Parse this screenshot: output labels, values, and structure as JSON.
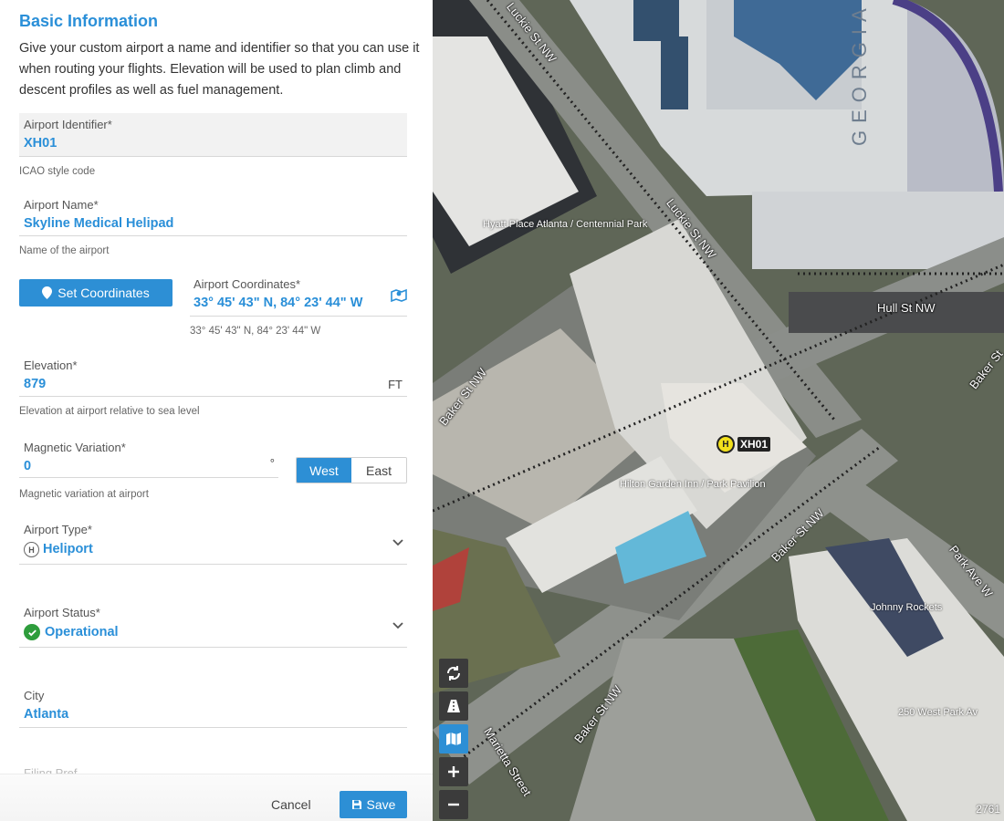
{
  "form": {
    "section_title": "Basic Information",
    "intro": "Give your custom airport a name and identifier so that you can use it when routing your flights. Elevation will be used to plan climb and descent profiles as well as fuel management.",
    "identifier": {
      "label": "Airport Identifier*",
      "value": "XH01",
      "hint": "ICAO style code"
    },
    "name": {
      "label": "Airport Name*",
      "value": "Skyline Medical Helipad",
      "hint": "Name of the airport"
    },
    "coordinates": {
      "button_label": "Set Coordinates",
      "label": "Airport Coordinates*",
      "value": "33° 45' 43\" N, 84° 23' 44\" W",
      "hint": "33° 45' 43\" N, 84° 23' 44\" W"
    },
    "elevation": {
      "label": "Elevation*",
      "value": "879",
      "unit": "FT",
      "hint": "Elevation at airport relative to sea level"
    },
    "magnetic_variation": {
      "label": "Magnetic Variation*",
      "value": "0",
      "unit": "°",
      "options": [
        "West",
        "East"
      ],
      "selected": "West",
      "hint": "Magnetic variation at airport"
    },
    "type": {
      "label": "Airport Type*",
      "value": "Heliport",
      "icon": "H"
    },
    "status": {
      "label": "Airport Status*",
      "value": "Operational"
    },
    "city": {
      "label": "City",
      "value": "Atlanta"
    },
    "next_field_cutoff": "Filing Pref",
    "footer": {
      "cancel": "Cancel",
      "save": "Save"
    }
  },
  "map": {
    "marker_label": "XH01",
    "marker_icon": "H",
    "streets": {
      "luckie_upper": "Luckie St NW",
      "luckie_lower": "Luckie St NW",
      "hull": "Hull St NW",
      "baker_left": "Baker St NW",
      "baker_mid": "Baker St NW",
      "baker_lower": "Baker St NW",
      "baker_right": "Baker St",
      "park": "Park Ave W",
      "marietta": "Marietta Street"
    },
    "poi": {
      "hyatt": "Hyatt Place Atlanta / Centennial Park",
      "hilton": "Hilton Garden Inn / Park Pavilion",
      "johnny": "Johnny Rockets",
      "west_park": "250 West Park Av"
    },
    "building_lettering": "GEORGIA",
    "scale": "2761"
  },
  "colors": {
    "accent": "#2a8fd8",
    "ok": "#2e9d3c",
    "marker": "#f2e01c"
  }
}
